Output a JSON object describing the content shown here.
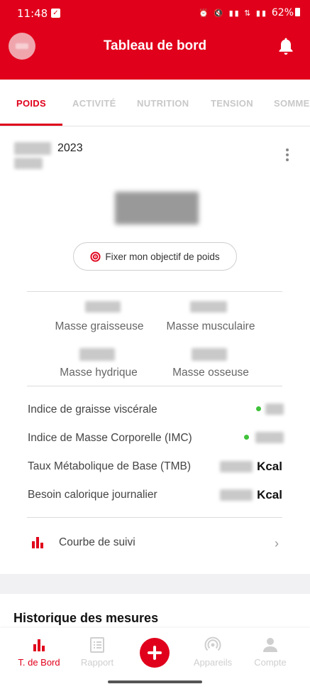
{
  "status_bar": {
    "time": "11:48",
    "battery": "62%"
  },
  "header": {
    "title": "Tableau de bord"
  },
  "tabs": [
    {
      "label": "POIDS",
      "active": true
    },
    {
      "label": "ACTIVITÉ",
      "active": false
    },
    {
      "label": "NUTRITION",
      "active": false
    },
    {
      "label": "TENSION",
      "active": false
    },
    {
      "label": "SOMMEIL",
      "active": false
    }
  ],
  "weight_card": {
    "year": "2023",
    "goal_button": "Fixer mon objectif de poids",
    "metrics": {
      "fat": "Masse graisseuse",
      "muscle": "Masse musculaire",
      "water": "Masse hydrique",
      "bone": "Masse osseuse"
    },
    "rows": {
      "visceral": "Indice de graisse viscérale",
      "bmi": "Indice de Masse Corporelle (IMC)",
      "bmr": "Taux Métabolique de Base (TMB)",
      "daily_calories": "Besoin calorique journalier",
      "unit": "Kcal"
    },
    "tracking_curve": "Courbe de suivi"
  },
  "history": {
    "title": "Historique des mesures"
  },
  "bottom_nav": {
    "dashboard": "T. de Bord",
    "report": "Rapport",
    "devices": "Appareils",
    "account": "Compte"
  },
  "colors": {
    "brand_red": "#e0001b",
    "status_green": "#3fc23a",
    "inactive_grey": "#c8c8c8"
  }
}
